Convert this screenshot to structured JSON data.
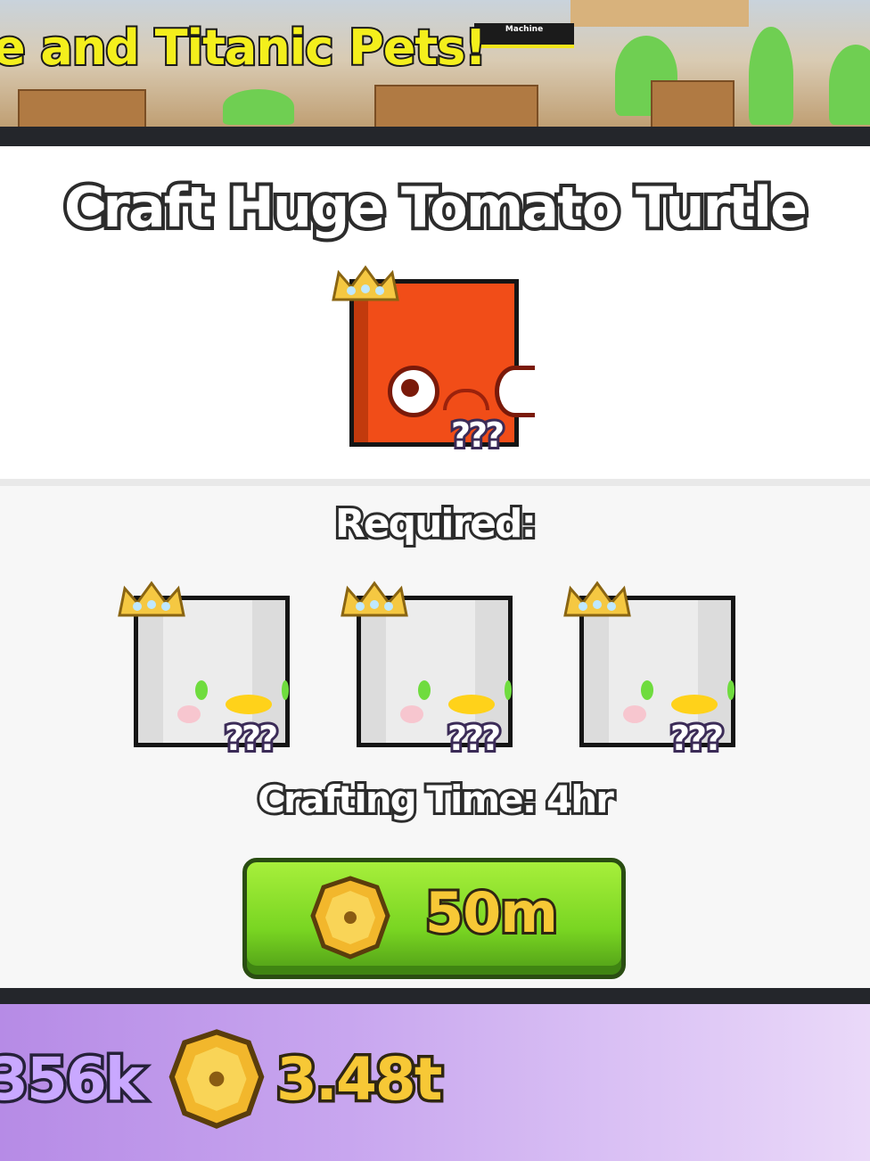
{
  "banner": {
    "headline": "e and Titanic Pets!",
    "sign_text": "Machine"
  },
  "craft_panel": {
    "title": "Craft Huge Tomato Turtle",
    "result_pet": {
      "unknown_label": "???",
      "color": "#f14d18"
    },
    "required_label": "Required:",
    "required_pets": [
      {
        "unknown_label": "???"
      },
      {
        "unknown_label": "???"
      },
      {
        "unknown_label": "???"
      }
    ],
    "crafting_time_label": "Crafting Time: 4hr",
    "craft_button": {
      "price": "50m",
      "icon": "coin-icon",
      "color": "#79d522"
    }
  },
  "currency_bar": {
    "left_amount": "356k",
    "coins_amount": "3.48t",
    "coin_icon": "coin-icon"
  }
}
